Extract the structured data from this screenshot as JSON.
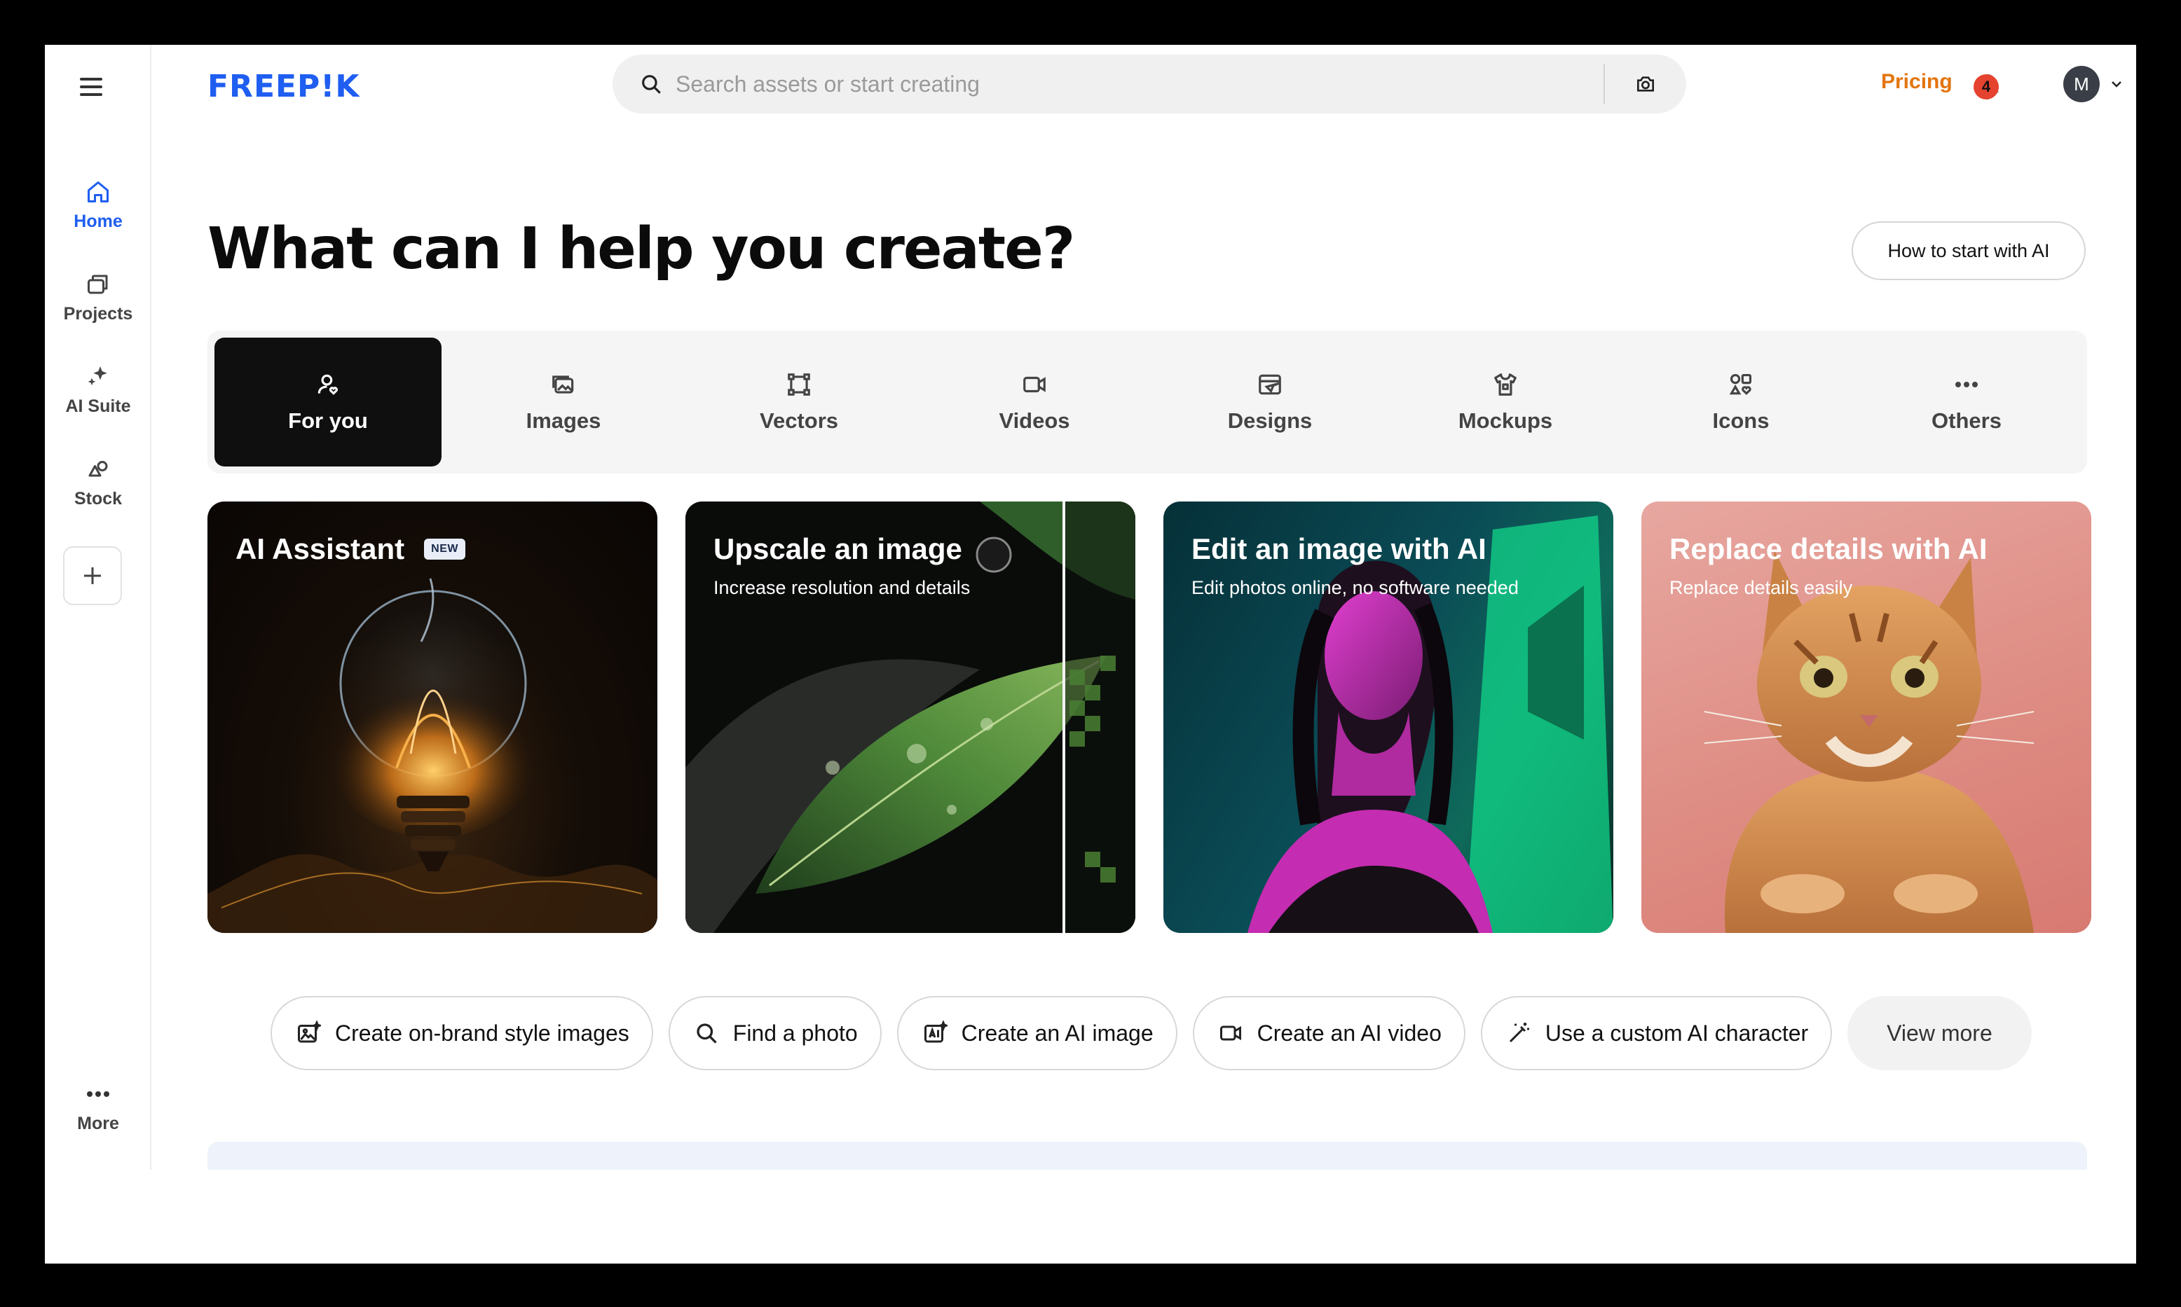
{
  "brand": {
    "logo_text": "FREEP!K",
    "accent": "#1f5ef0",
    "pricing_color": "#e3750f"
  },
  "header": {
    "search_placeholder": "Search assets or start creating",
    "pricing_label": "Pricing",
    "notification_count": "4",
    "avatar_initial": "M"
  },
  "sidebar": {
    "items": [
      {
        "label": "Home",
        "icon": "home-icon",
        "active": true
      },
      {
        "label": "Projects",
        "icon": "projects-icon"
      },
      {
        "label": "AI Suite",
        "icon": "sparkles-icon"
      },
      {
        "label": "Stock",
        "icon": "stock-icon"
      }
    ],
    "more_label": "More"
  },
  "main": {
    "headline": "What can I help you create?",
    "how_button": "How to start with AI",
    "tabs": [
      {
        "label": "For you",
        "icon": "user-heart-icon",
        "active": true
      },
      {
        "label": "Images",
        "icon": "images-icon"
      },
      {
        "label": "Vectors",
        "icon": "vector-icon"
      },
      {
        "label": "Videos",
        "icon": "video-icon"
      },
      {
        "label": "Designs",
        "icon": "designs-icon"
      },
      {
        "label": "Mockups",
        "icon": "mockup-shirt-icon"
      },
      {
        "label": "Icons",
        "icon": "icons-grid-icon"
      },
      {
        "label": "Others",
        "icon": "ellipsis-icon"
      }
    ],
    "cards": [
      {
        "title": "AI Assistant",
        "badge": "NEW",
        "subtitle": ""
      },
      {
        "title": "Upscale an image",
        "subtitle": "Increase resolution and details"
      },
      {
        "title": "Edit an image with AI",
        "subtitle": "Edit photos online, no software needed"
      },
      {
        "title": "Replace details with AI",
        "subtitle": "Replace details easily"
      }
    ],
    "chips": [
      {
        "label": "Create on-brand style images",
        "icon": "image-sparkle-icon"
      },
      {
        "label": "Find a photo",
        "icon": "search-icon"
      },
      {
        "label": "Create an AI image",
        "icon": "ai-image-icon"
      },
      {
        "label": "Create an AI video",
        "icon": "video-icon"
      },
      {
        "label": "Use a custom AI character",
        "icon": "magic-wand-icon"
      }
    ],
    "view_more": "View more"
  }
}
